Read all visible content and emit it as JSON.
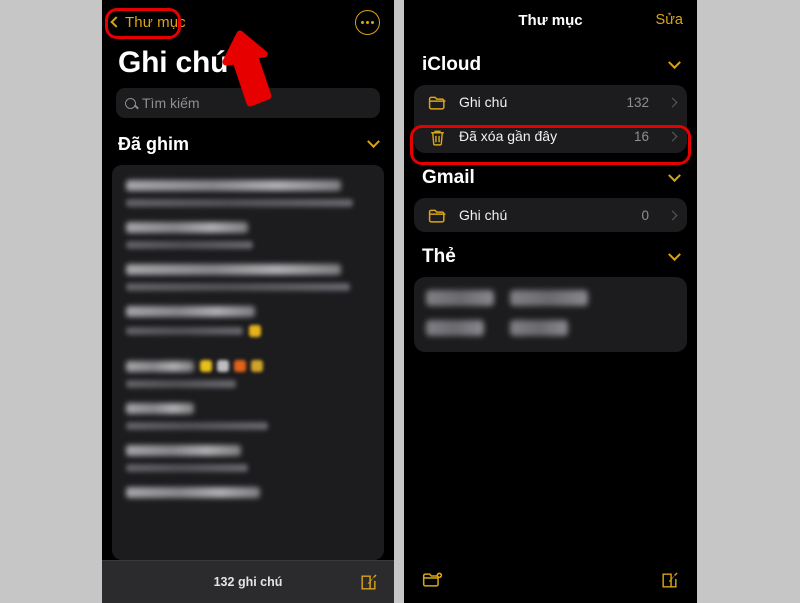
{
  "theme": {
    "page_background": "#c6c6c6",
    "panel_background": "#000000",
    "card_background": "#1c1c1e",
    "accent_gold": "#d9a418",
    "annotation_red": "#e60000",
    "primary_text": "#ffffff",
    "secondary_text": "#8e8e93"
  },
  "left_panel": {
    "navbar": {
      "back_label": "Thư mục",
      "back_icon": "chevron-left-icon",
      "more_icon": "ellipsis-circle-icon"
    },
    "title": "Ghi chú",
    "search": {
      "placeholder": "Tìm kiếm",
      "value": "",
      "icon": "search-icon"
    },
    "pinned_section": {
      "label": "Đã ghim",
      "chevron_icon": "chevron-down-icon"
    },
    "notes_redacted_count": 8,
    "toolbar": {
      "count_label": "132 ghi chú",
      "compose_icon": "compose-icon"
    }
  },
  "right_panel": {
    "navbar": {
      "title": "Thư mục",
      "edit_label": "Sửa"
    },
    "sections": [
      {
        "name": "iCloud",
        "chevron_icon": "chevron-down-icon",
        "rows": [
          {
            "icon": "folder-icon",
            "label": "Ghi chú",
            "count": "132",
            "chevron_icon": "chevron-right-icon",
            "highlighted": false
          },
          {
            "icon": "trash-icon",
            "label": "Đã xóa gần đây",
            "count": "16",
            "chevron_icon": "chevron-right-icon",
            "highlighted": true
          }
        ]
      },
      {
        "name": "Gmail",
        "chevron_icon": "chevron-down-icon",
        "rows": [
          {
            "icon": "folder-icon",
            "label": "Ghi chú",
            "count": "0",
            "chevron_icon": "chevron-right-icon",
            "highlighted": false
          }
        ]
      },
      {
        "name": "Thẻ",
        "chevron_icon": "chevron-down-icon",
        "tags_redacted_count": 4
      }
    ],
    "toolbar": {
      "new_folder_icon": "new-folder-icon",
      "compose_icon": "compose-icon"
    }
  },
  "annotations": {
    "highlight_back_button": "Thư mục",
    "highlight_row": "Đã xóa gần đây",
    "arrow_icon": "arrow-pointer-icon",
    "color": "#e60000"
  }
}
